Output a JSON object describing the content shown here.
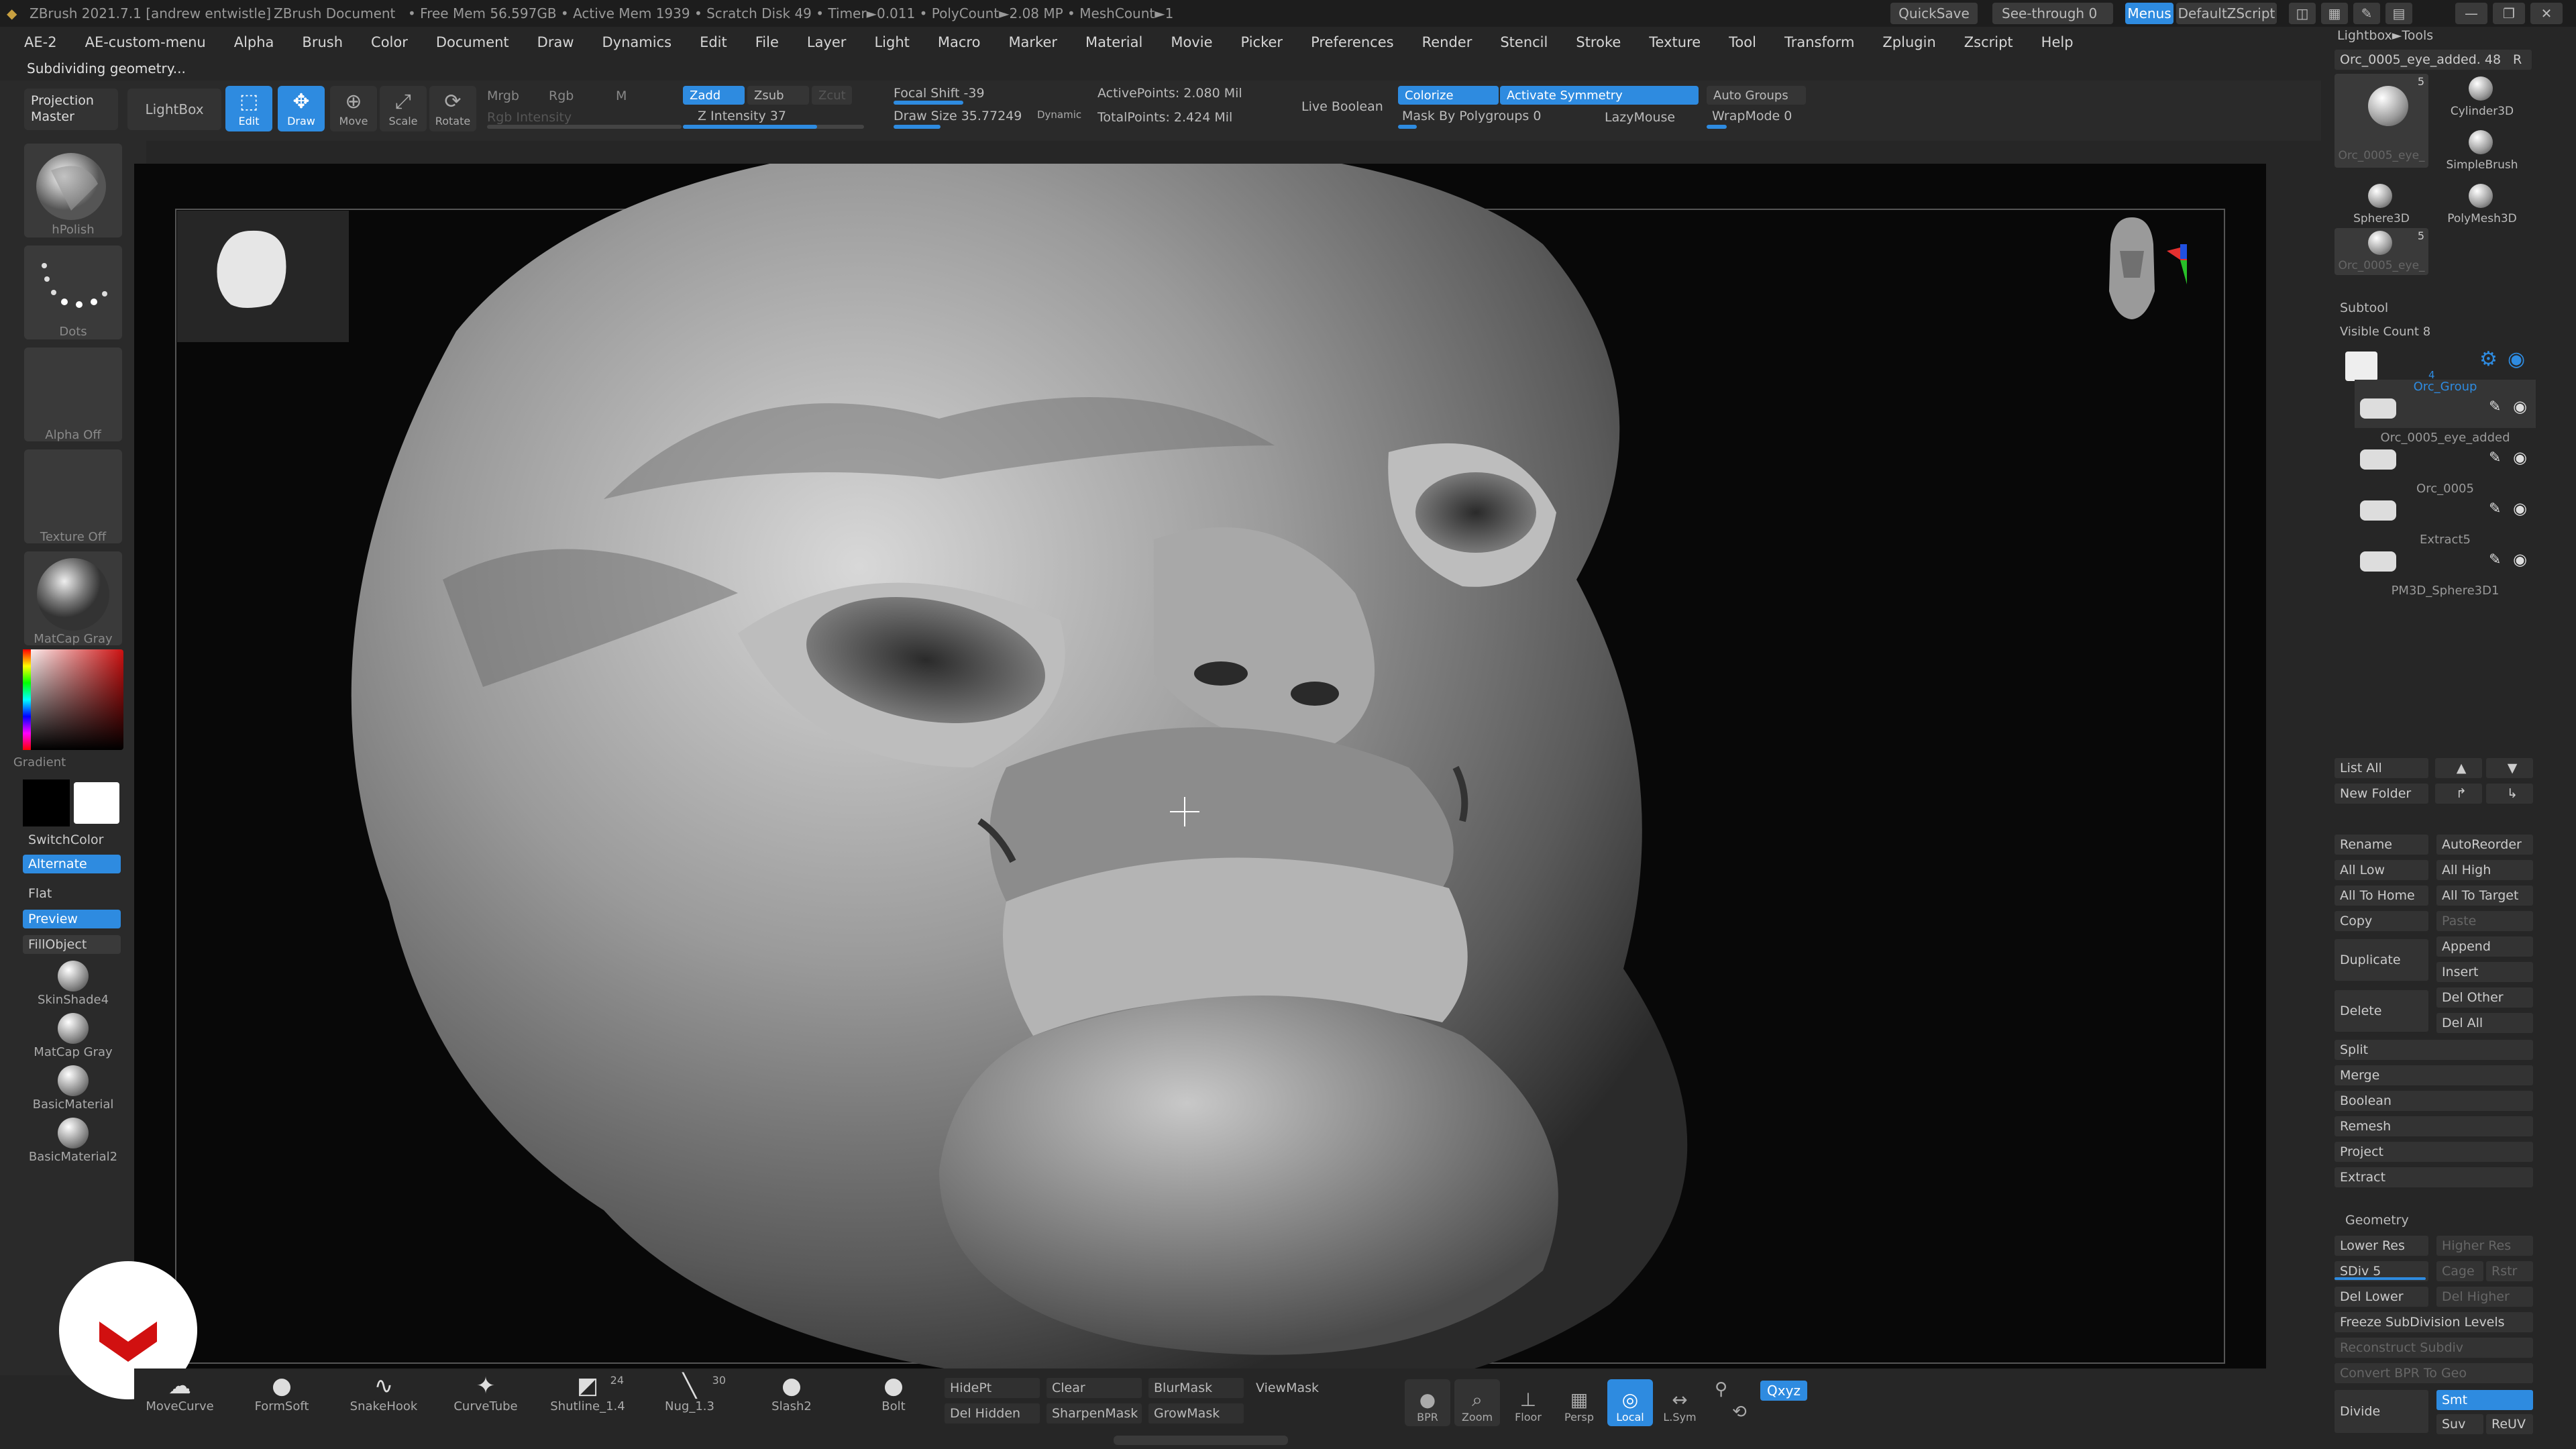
{
  "titlebar": {
    "app": "ZBrush 2021.7.1 [andrew entwistle]",
    "document": "ZBrush Document",
    "stats": "• Free Mem 56.597GB • Active Mem 1939 • Scratch Disk 49 • Timer►0.011 • PolyCount►2.08 MP • MeshCount►1",
    "quicksave": "QuickSave",
    "see_through": "See-through  0",
    "menus": "Menus",
    "default_zscript": "DefaultZScript"
  },
  "menu_items": [
    "AE-2",
    "AE-custom-menu",
    "Alpha",
    "Brush",
    "Color",
    "Document",
    "Draw",
    "Dynamics",
    "Edit",
    "File",
    "Layer",
    "Light",
    "Macro",
    "Marker",
    "Material",
    "Movie",
    "Picker",
    "Preferences",
    "Render",
    "Stencil",
    "Stroke",
    "Texture",
    "Tool",
    "Transform",
    "Zplugin",
    "Zscript",
    "Help"
  ],
  "status_line": "Subdividing geometry...",
  "toolbar": {
    "projection_master": "Projection Master",
    "lightbox": "LightBox",
    "edit": "Edit",
    "draw": "Draw",
    "move": "Move",
    "scale": "Scale",
    "rotate": "Rotate",
    "mrgb": "Mrgb",
    "rgb": "Rgb",
    "m": "M",
    "rgb_intensity": "Rgb Intensity",
    "zadd": "Zadd",
    "zsub": "Zsub",
    "zcut": "Zcut",
    "z_intensity": "Z Intensity 37",
    "focal_shift": "Focal Shift -39",
    "draw_size": "Draw Size 35.77249",
    "dynamic": "Dynamic",
    "active_points": "ActivePoints: 2.080 Mil",
    "total_points": "TotalPoints: 2.424 Mil",
    "live_boolean": "Live Boolean",
    "colorize": "Colorize",
    "activate_symmetry": "Activate Symmetry",
    "mask_by_polygroups": "Mask By Polygroups 0",
    "lazymouse": "LazyMouse",
    "auto_groups": "Auto Groups",
    "wrapmode": "WrapMode 0"
  },
  "left_panel": {
    "brush": "hPolish",
    "stroke": "Dots",
    "alpha": "Alpha Off",
    "texture": "Texture Off",
    "material": "MatCap Gray",
    "gradient": "Gradient",
    "switchcolor": "SwitchColor",
    "alternate": "Alternate",
    "flat": "Flat",
    "preview": "Preview",
    "fillobject": "FillObject",
    "materials": [
      "SkinShade4",
      "MatCap Gray",
      "BasicMaterial",
      "BasicMaterial2"
    ]
  },
  "right_panel": {
    "lightbox_tools": "Lightbox►Tools",
    "current_tool": "Orc_0005_eye_added. 48",
    "r_button": "R",
    "tool_thumbs": [
      {
        "label": "Orc_0005_eye_",
        "count": "5"
      },
      {
        "label": "Cylinder3D",
        "count": ""
      },
      {
        "label": "SimpleBrush",
        "count": ""
      },
      {
        "label": "Sphere3D",
        "count": ""
      },
      {
        "label": "PolyMesh3D",
        "count": ""
      },
      {
        "label": "Orc_0005_eye_",
        "count": "5"
      }
    ],
    "subtool_header": "Subtool",
    "visible_count": "Visible Count 8",
    "subtools": [
      {
        "name": "Orc_Group",
        "count": "4"
      },
      {
        "name": "Orc_0005_eye_added",
        "count": ""
      },
      {
        "name": "Orc_0005",
        "count": ""
      },
      {
        "name": "Extract5",
        "count": ""
      },
      {
        "name": "PM3D_Sphere3D1",
        "count": ""
      }
    ],
    "list_all": "List All",
    "new_folder": "New Folder",
    "rename": "Rename",
    "autoreorder": "AutoReorder",
    "all_low": "All Low",
    "all_high": "All High",
    "all_to_home": "All To Home",
    "all_to_target": "All To Target",
    "copy": "Copy",
    "paste": "Paste",
    "duplicate": "Duplicate",
    "append": "Append",
    "insert": "Insert",
    "delete": "Delete",
    "del_other": "Del Other",
    "del_all": "Del All",
    "split": "Split",
    "merge": "Merge",
    "boolean": "Boolean",
    "remesh": "Remesh",
    "project": "Project",
    "extract": "Extract",
    "geometry_header": "Geometry",
    "lower_res": "Lower Res",
    "higher_res": "Higher Res",
    "sdiv": "SDiv 5",
    "cage": "Cage",
    "rstr": "Rstr",
    "del_lower": "Del Lower",
    "del_higher": "Del Higher",
    "freeze_subdivision": "Freeze SubDivision Levels",
    "reconstruct_subdiv": "Reconstruct Subdiv",
    "convert_bpr": "Convert BPR To Geo",
    "divide": "Divide",
    "smt": "Smt",
    "suv": "Suv",
    "reuv": "ReUV"
  },
  "bottom_bar": {
    "brushes": [
      {
        "name": "MoveCurve",
        "count": ""
      },
      {
        "name": "FormSoft",
        "count": ""
      },
      {
        "name": "SnakeHook",
        "count": ""
      },
      {
        "name": "CurveTube",
        "count": ""
      },
      {
        "name": "Shutline_1.4",
        "count": "24"
      },
      {
        "name": "Nug_1.3",
        "count": "30"
      },
      {
        "name": "Slash2",
        "count": ""
      },
      {
        "name": "Bolt",
        "count": ""
      }
    ],
    "hidept": "HidePt",
    "clear": "Clear",
    "blurmask": "BlurMask",
    "viewmask": "ViewMask",
    "del_hidden": "Del Hidden",
    "sharpenmask": "SharpenMask",
    "growmask": "GrowMask",
    "bpr": "BPR",
    "zoom": "Zoom",
    "floor": "Floor",
    "persp": "Persp",
    "local": "Local",
    "lsym": "L.Sym",
    "xyz": "Qxyz"
  },
  "colors": {
    "accent": "#2e8be0",
    "panel": "#262626",
    "viewport": "#080808"
  }
}
